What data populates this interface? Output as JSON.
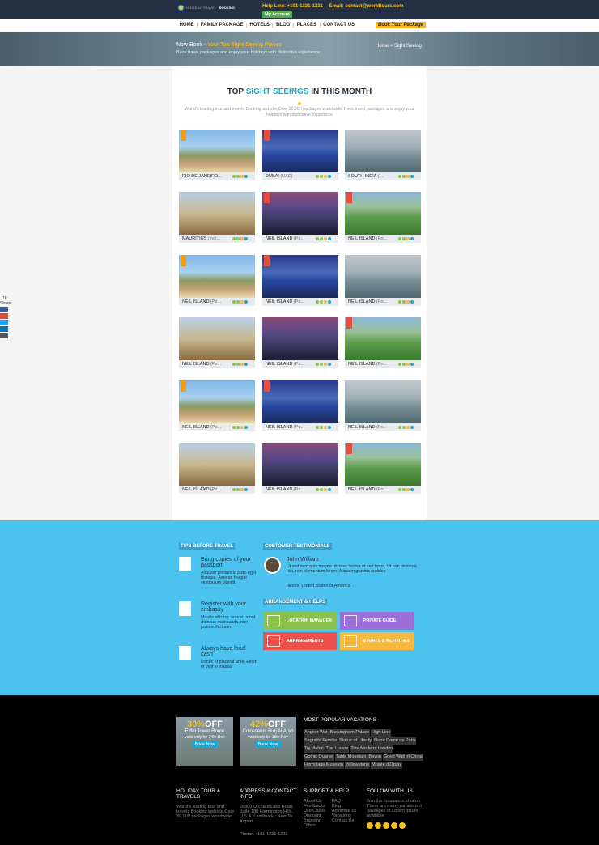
{
  "header": {
    "brand_top": "HOLIDAY TRAVEL",
    "brand_bottom": "BOOKING",
    "helpline": "Help Line: +101-1231-1231",
    "email": "Email: contact@worldtours.com",
    "my_account": "My Account"
  },
  "nav": {
    "items": [
      "HOME",
      "FAMILY PACKAGE",
      "HOTELS",
      "BLOG",
      "PLACES",
      "CONTACT US"
    ],
    "book": "Book Your Package"
  },
  "banner": {
    "title_prefix": "Now Book - ",
    "title_highlight": "Your Top Sight Seeing Places",
    "subtitle": "Book travel packages and enjoy your holidays with distinctive experience",
    "breadcrumb": "Home > Sight Seeing"
  },
  "section": {
    "title_a": "TOP ",
    "title_b": "SIGHT SEEINGS",
    "title_c": " IN THIS MONTH",
    "desc": "World's leading tour and travels Booking website,Over 30,000 packages worldwide. Book travel packages and enjoy your holidays with distinctive experience"
  },
  "cards": [
    {
      "name": "RIO DE JANEIRO...",
      "sub": "",
      "img": "statue",
      "offer": "orange"
    },
    {
      "name": "DUBAI",
      "sub": " (UAE)",
      "img": "dubai",
      "offer": "red"
    },
    {
      "name": "SOUTH INDIA",
      "sub": " (I...",
      "img": "girl",
      "offer": ""
    },
    {
      "name": "MAURITIUS",
      "sub": " (Indi...",
      "img": "tower",
      "offer": ""
    },
    {
      "name": "NEIL ISLAND",
      "sub": " (Po...",
      "img": "bridge",
      "offer": "red"
    },
    {
      "name": "NEIL ISLAND",
      "sub": " (Po...",
      "img": "train",
      "offer": "red"
    },
    {
      "name": "NEIL ISLAND",
      "sub": " (Po...",
      "img": "statue",
      "offer": "orange"
    },
    {
      "name": "NEIL ISLAND",
      "sub": " (Po...",
      "img": "dubai",
      "offer": "red"
    },
    {
      "name": "NEIL ISLAND",
      "sub": " (Po...",
      "img": "girl",
      "offer": ""
    },
    {
      "name": "NEIL ISLAND",
      "sub": " (Po...",
      "img": "tower",
      "offer": ""
    },
    {
      "name": "NEIL ISLAND",
      "sub": " (Po...",
      "img": "bridge",
      "offer": ""
    },
    {
      "name": "NEIL ISLAND",
      "sub": " (Po...",
      "img": "train",
      "offer": "red"
    },
    {
      "name": "NEIL ISLAND",
      "sub": " (Po...",
      "img": "statue",
      "offer": "orange"
    },
    {
      "name": "NEIL ISLAND",
      "sub": " (Po...",
      "img": "dubai",
      "offer": "red"
    },
    {
      "name": "NEIL ISLAND",
      "sub": " (Po...",
      "img": "girl",
      "offer": ""
    },
    {
      "name": "NEIL ISLAND",
      "sub": " (Po...",
      "img": "tower",
      "offer": ""
    },
    {
      "name": "NEIL ISLAND",
      "sub": " (Po...",
      "img": "bridge",
      "offer": ""
    },
    {
      "name": "NEIL ISLAND",
      "sub": " (Po...",
      "img": "train",
      "offer": "red"
    }
  ],
  "share": {
    "count": "1k",
    "label": "Share"
  },
  "tips": {
    "title": "TIPS BEFORE TRAVEL",
    "items": [
      {
        "title": "Bring copies of your passport",
        "desc": "Aliquam pretium id justo eget tristique. Aenean feugiat vestibulum blandit."
      },
      {
        "title": "Register with your embassy",
        "desc": "Mauris efficitur, ante sit amet rhoncus malesuada, orci justo sollicitudin."
      },
      {
        "title": "Always have local cash",
        "desc": "Donec et placerat ante. Etiam et velit in massa."
      }
    ]
  },
  "testimonials": {
    "title": "CUSTOMER TESTIMONIALS",
    "name": "John William",
    "text": "Ut sed sem quis magna ultricies lacinia et sed tortor. Ut non tincidunt nisi, non elementum lorem. Aliquam gravida sodales",
    "location": "Illinois, United States of America"
  },
  "arrangement": {
    "title": "ARRANGEMENT & HELPS",
    "buttons": [
      "LOCATION MANAGER",
      "PRIVATE GUIDE",
      "ARRANGEMENTS",
      "EVENTS & ACTIVITIES"
    ]
  },
  "promos": [
    {
      "pct": "30%",
      "off": "OFF",
      "name": "Eiffel Tower Rome",
      "valid": "valid only for 24th Dec",
      "btn": "Book Now"
    },
    {
      "pct": "42%",
      "off": "OFF",
      "name": "Colosseum Burj Al Arab",
      "valid": "valid only for 18th Nov",
      "btn": "Book Now"
    }
  ],
  "popular": {
    "title": "MOST POPULAR VACATIONS",
    "tags": [
      "Angkor Wat",
      "Buckingham Palace",
      "High Line",
      "Sagrada Familia",
      "Statue of Liberty",
      "Notre Dame de Paris",
      "Taj Mahal",
      "The Louvre",
      "Tate Modern, London",
      "Gothic Quarter",
      "Table Mountain",
      "Bayon",
      "Great Wall of China",
      "Hermitage Museum",
      "Yellowstone",
      "Musée d'Orsay"
    ]
  },
  "footer": {
    "col1_title": "HOLIDAY TOUR & TRAVELS",
    "col1_text": "World's leading tour and travels Booking website,Over 30,000 packages worldwide.",
    "col2_title": "ADDRESS & CONTACT INFO",
    "col2_text": "28800 Orchard Lake Road, Suite 180 Farmington Hills, U.S.A. Landmark : Next To Airport",
    "col2_phone": "Phone: +101-1231-1231",
    "col3_title": "SUPPORT & HELP",
    "col3_a": [
      "About Us",
      "Feedbacks",
      "Use Cases",
      "Discount",
      "Branding Offers"
    ],
    "col3_b": [
      "FAQ",
      "Blog",
      "Advertise us",
      "Vacations",
      "Contact Us"
    ],
    "col4_title": "FOLLOW WITH US",
    "col4_text": "Join the thousands of other There are many variations of passages of Lorem Ipsum available"
  },
  "colors": {
    "accent": "#1fa7c8",
    "yellow": "#f5c020",
    "blue_section": "#4bc3ee",
    "green_btn": "#8bc34a",
    "purple_btn": "#9c6fd6",
    "red_btn": "#f0504a",
    "yellow_btn": "#f5b841"
  }
}
